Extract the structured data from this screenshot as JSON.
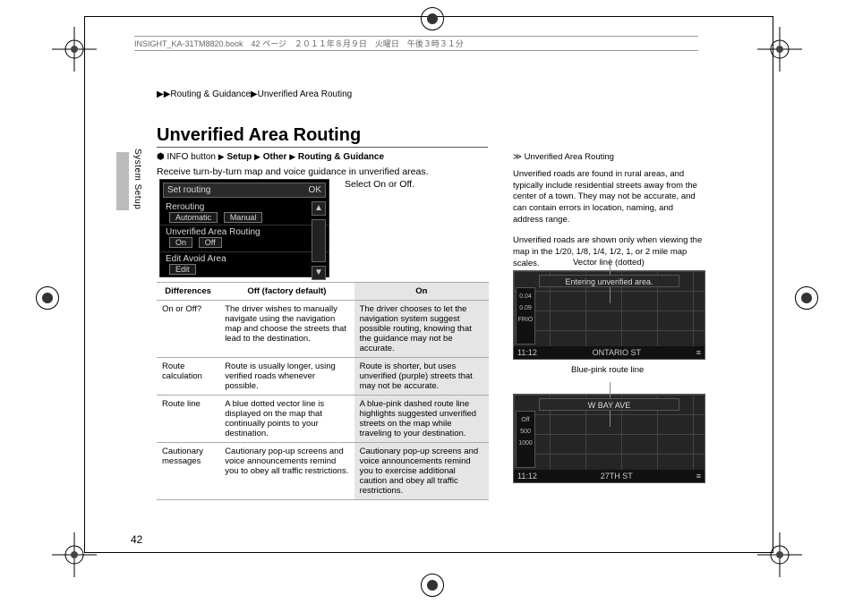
{
  "meta_header": "INSIGHT_KA-31TM8820.book　42 ページ　２０１１年８月９日　火曜日　午後３時３１分",
  "breadcrumb": {
    "p1": "Routing & Guidance",
    "p2": "Unverified Area Routing"
  },
  "section_side": "System Setup",
  "title": "Unverified Area Routing",
  "nav": {
    "info_btn": "INFO button",
    "s1": "Setup",
    "s2": "Other",
    "s3": "Routing & Guidance"
  },
  "intro": "Receive turn-by-turn map and voice guidance in unverified areas.",
  "select_text": "Select On or Off.",
  "set_routing": {
    "title": "Set routing",
    "ok": "OK",
    "row1_label": "Rerouting",
    "row1_btn1": "Automatic",
    "row1_btn2": "Manual",
    "row2_label": "Unverified Area Routing",
    "row2_btn1": "On",
    "row2_btn2": "Off",
    "row3_label": "Edit Avoid Area",
    "row3_btn1": "Edit"
  },
  "table": {
    "h1": "Differences",
    "h2": "Off (factory default)",
    "h3": "On",
    "rows": [
      {
        "d": "On or Off?",
        "off": "The driver wishes to manually navigate using the navigation map and choose the streets that lead to the destination.",
        "on": "The driver chooses to let the navigation system suggest possible routing, knowing that the guidance may not be accurate."
      },
      {
        "d": "Route calculation",
        "off": "Route is usually longer, using verified roads whenever possible.",
        "on": "Route is shorter, but uses unverified (purple) streets that may not be accurate."
      },
      {
        "d": "Route line",
        "off": "A blue dotted vector line is displayed on the map that continually points to your destination.",
        "on": "A blue-pink dashed route line highlights suggested unverified streets on the map while traveling to your destination."
      },
      {
        "d": "Cautionary messages",
        "off": "Cautionary pop-up screens and voice announcements remind you to obey all traffic restrictions.",
        "on": "Cautionary pop-up screens and voice announcements remind you to exercise additional caution and obey all traffic restrictions."
      }
    ]
  },
  "right": {
    "head": "Unverified Area Routing",
    "p1": "Unverified roads are found in rural areas, and typically include residential streets away from the center of a town. They may not be accurate, and can contain errors in location, naming, and address range.",
    "p2": "Unverified roads are shown only when viewing the map in the 1/20, 1/8, 1/4, 1/2, 1, or 2 mile map scales.",
    "label1": "Vector line (dotted)",
    "label2": "Blue-pink route line"
  },
  "map1": {
    "top": "Entering unverified area.",
    "time": "11:12",
    "street": "ONTARIO ST",
    "g1": "0.04",
    "g2": "0.09",
    "g3": "FRIO"
  },
  "map2": {
    "top": "W BAY AVE",
    "time": "11:12",
    "street": "27TH ST",
    "g1": "Off",
    "g2": "500",
    "g3": "1000"
  },
  "page_number": "42"
}
